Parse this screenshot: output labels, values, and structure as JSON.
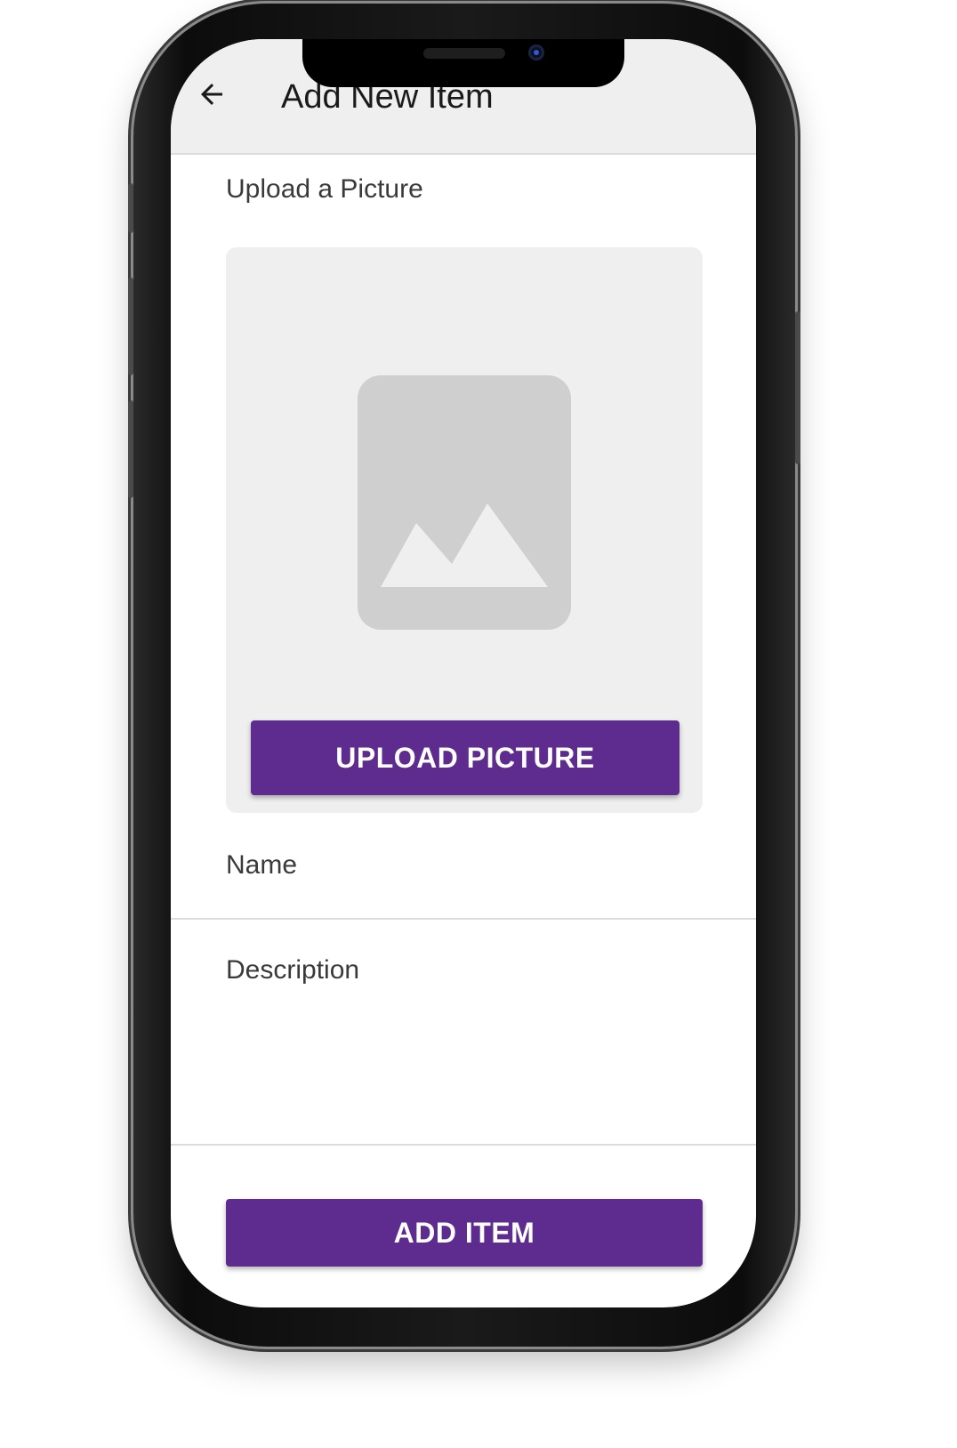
{
  "app_bar": {
    "title": "Add New Item",
    "back_icon": "arrow-left-icon",
    "background": "#efefef"
  },
  "upload": {
    "section_label": "Upload a Picture",
    "placeholder_icon": "image-placeholder-icon",
    "button_label": "UPLOAD PICTURE"
  },
  "form": {
    "name_label": "Name",
    "description_label": "Description",
    "submit_label": "ADD ITEM"
  },
  "colors": {
    "accent": "#5e2b8f",
    "card_background": "#efefef",
    "divider": "#dcdcdc"
  }
}
